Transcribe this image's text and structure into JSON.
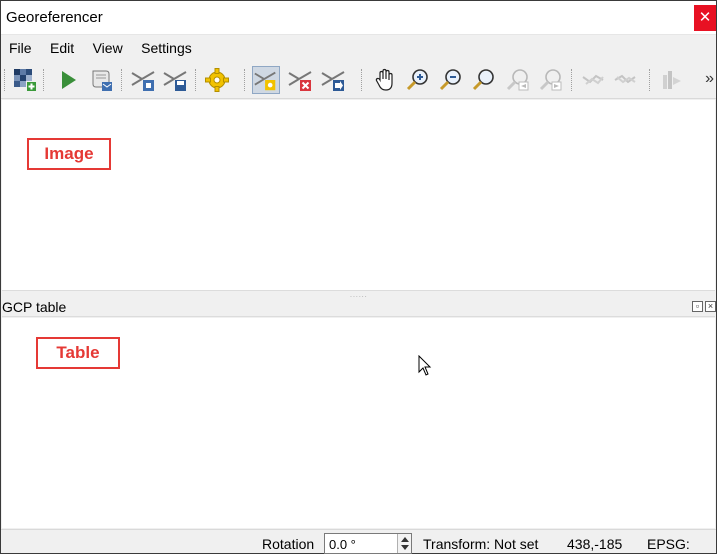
{
  "window": {
    "title": "Georeferencer",
    "close_glyph": "✕"
  },
  "menu": {
    "items": [
      "File",
      "Edit",
      "View",
      "Settings"
    ]
  },
  "toolbar": {
    "icons": [
      "open-raster-icon",
      "start-georeferencing-icon",
      "generate-gdal-script-icon",
      "load-gcp-points-icon",
      "save-gcp-points-icon",
      "transformation-settings-icon",
      "add-point-icon",
      "delete-point-icon",
      "move-gcp-point-icon",
      "pan-icon",
      "zoom-in-icon",
      "zoom-out-icon",
      "zoom-to-layer-icon",
      "zoom-last-icon",
      "zoom-next-icon",
      "link-georeferencer-to-qgis-icon",
      "link-qgis-to-georeferencer-icon",
      "full-histogram-stretch-icon"
    ],
    "more_glyph": "»"
  },
  "canvas": {
    "annotation": "Image"
  },
  "gcp_dock": {
    "title": "GCP table",
    "annotation": "Table"
  },
  "status": {
    "rotation_label": "Rotation",
    "rotation_value": "0.0 °",
    "transform": "Transform: Not set",
    "coordinates": "438,-185",
    "epsg": "EPSG:"
  },
  "colors": {
    "annotation": "#e53935",
    "close_button": "#e81123",
    "active_tool": "#cfd8e3"
  }
}
